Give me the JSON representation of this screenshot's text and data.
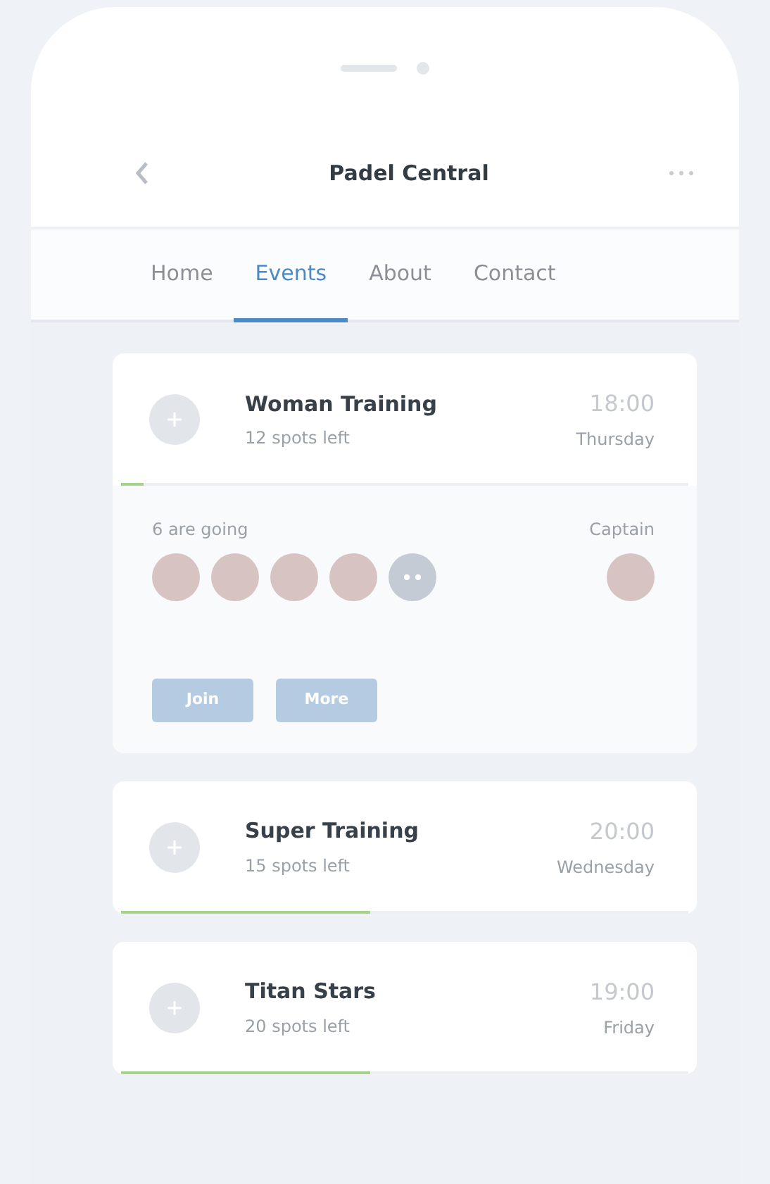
{
  "header": {
    "title": "Padel Central"
  },
  "tabs": [
    {
      "label": "Home",
      "selected": false
    },
    {
      "label": "Events",
      "selected": true
    },
    {
      "label": "About",
      "selected": false
    },
    {
      "label": "Contact",
      "selected": false
    }
  ],
  "events": [
    {
      "name": "Woman Training",
      "spots": "12 spots left",
      "time": "18:00",
      "day": "Thursday",
      "level": 0.04,
      "expanded": true,
      "going": "6 are going",
      "attendees": [
        {
          "kind": "photo"
        },
        {
          "kind": "photo"
        },
        {
          "kind": "photo"
        },
        {
          "kind": "photo"
        },
        {
          "kind": "more"
        }
      ],
      "captain_label": "Captain",
      "actions": [
        "Join",
        "More"
      ]
    },
    {
      "name": "Super Training",
      "spots": "15 spots left",
      "time": "20:00",
      "day": "Wednesday",
      "level": 0.44,
      "expanded": false
    },
    {
      "name": "Titan Stars",
      "spots": "20 spots left",
      "time": "19:00",
      "day": "Friday",
      "level": 0.44,
      "expanded": false
    }
  ]
}
